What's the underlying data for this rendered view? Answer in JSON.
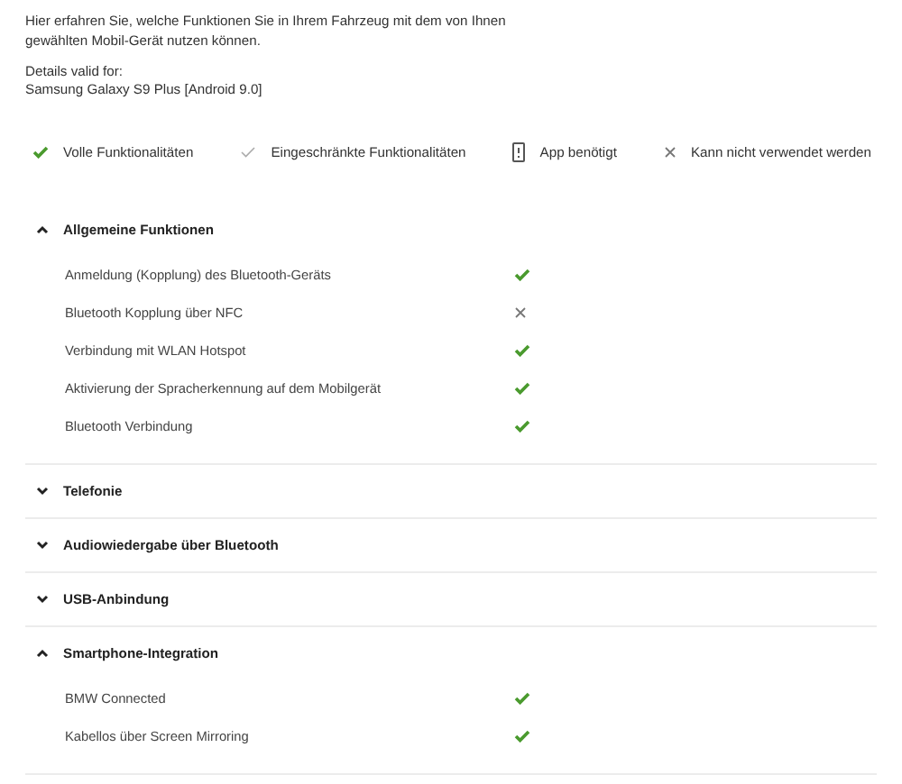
{
  "intro": "Hier erfahren Sie, welche Funktionen Sie in Ihrem Fahrzeug mit dem von Ihnen gewählten Mobil-Gerät nutzen können.",
  "details_label": "Details valid for:",
  "device": "Samsung Galaxy S9 Plus [Android 9.0]",
  "legend": [
    {
      "kind": "full",
      "label": "Volle Funktionalitäten"
    },
    {
      "kind": "limited",
      "label": "Eingeschränkte Funktionalitäten"
    },
    {
      "kind": "app",
      "label": "App benötigt"
    },
    {
      "kind": "none",
      "label": "Kann nicht verwendet werden"
    }
  ],
  "sections": [
    {
      "title": "Allgemeine Funktionen",
      "expanded": true,
      "rows": [
        {
          "name": "Anmeldung (Kopplung) des Bluetooth-Geräts",
          "kind": "full"
        },
        {
          "name": "Bluetooth Kopplung über NFC",
          "kind": "none"
        },
        {
          "name": "Verbindung mit WLAN Hotspot",
          "kind": "full"
        },
        {
          "name": "Aktivierung der Spracherkennung auf dem Mobilgerät",
          "kind": "full"
        },
        {
          "name": "Bluetooth Verbindung",
          "kind": "full"
        }
      ]
    },
    {
      "title": "Telefonie",
      "expanded": false
    },
    {
      "title": "Audiowiedergabe über Bluetooth",
      "expanded": false
    },
    {
      "title": "USB-Anbindung",
      "expanded": false
    },
    {
      "title": "Smartphone-Integration",
      "expanded": true,
      "rows": [
        {
          "name": "BMW Connected",
          "kind": "full"
        },
        {
          "name": "Kabellos über Screen Mirroring",
          "kind": "full"
        }
      ]
    }
  ]
}
